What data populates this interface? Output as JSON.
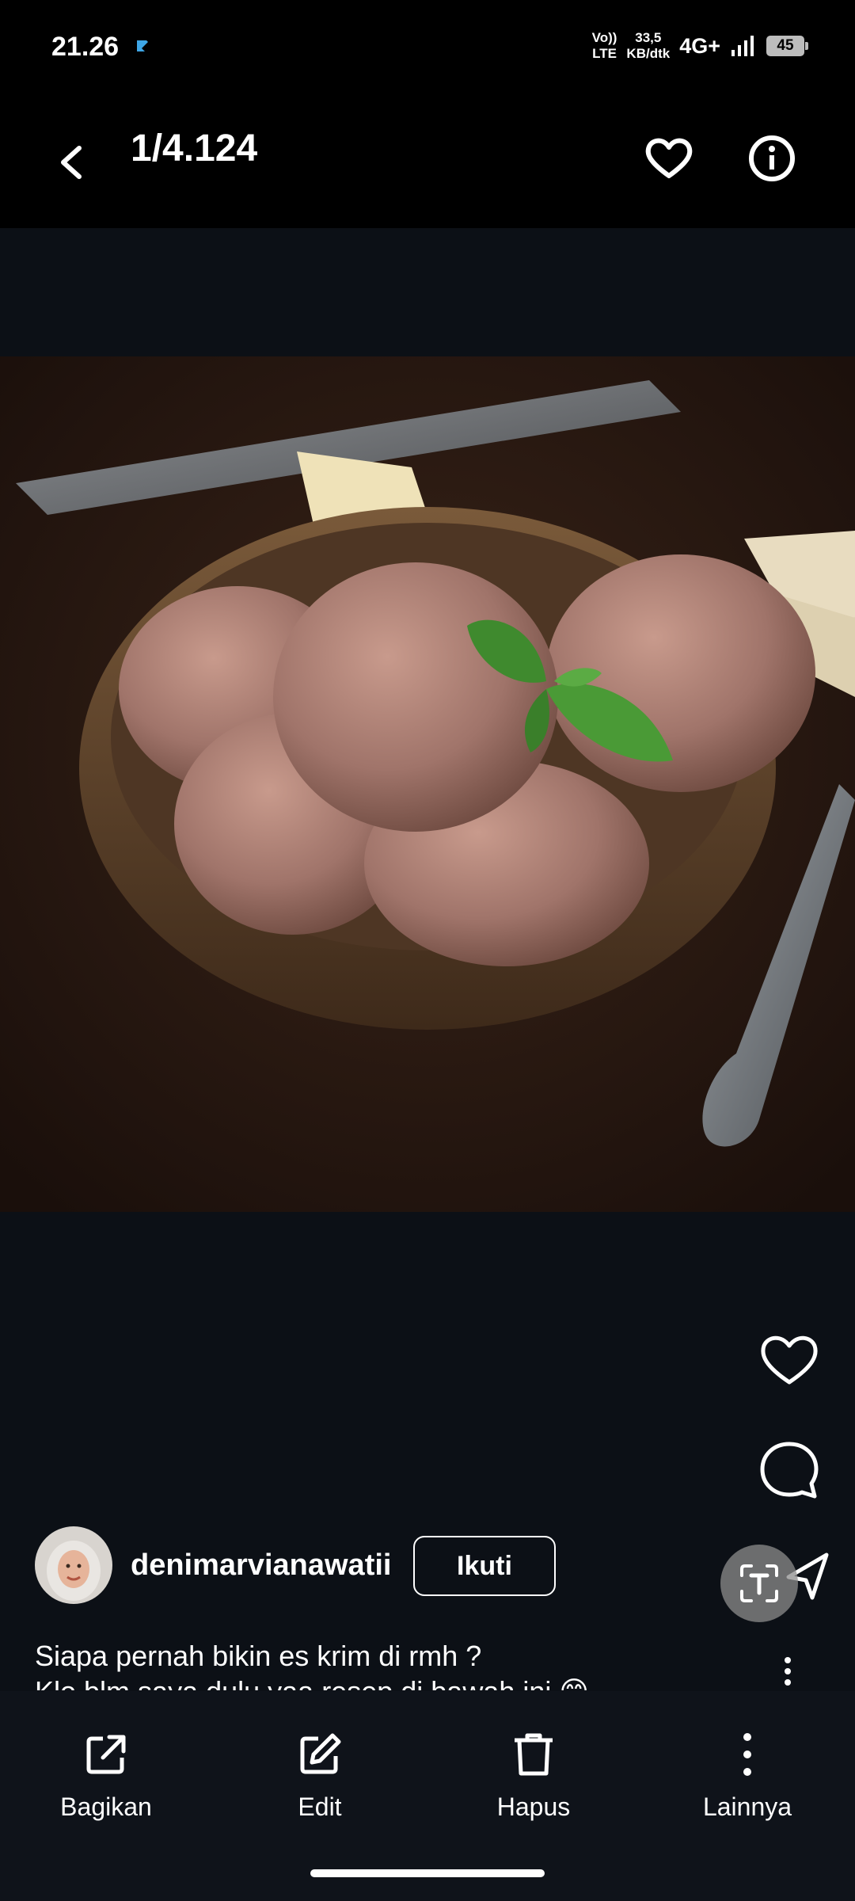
{
  "status": {
    "time": "21.26",
    "volte_top": "Vo))",
    "volte_bottom": "LTE",
    "speed_value": "33,5",
    "speed_unit": "KB/dtk",
    "network": "4G+",
    "battery": "45"
  },
  "viewer": {
    "counter": "1/4.124"
  },
  "post": {
    "username": "denimarvianawatii",
    "follow_label": "Ikuti",
    "caption_line1": "Siapa pernah bikin es krim di rmh ?",
    "caption_line2": "Klo blm saya dulu yaa resep di bawah ini 😊"
  },
  "actions": [
    {
      "label": "Bagikan",
      "icon": "share-icon"
    },
    {
      "label": "Edit",
      "icon": "edit-icon"
    },
    {
      "label": "Hapus",
      "icon": "trash-icon"
    },
    {
      "label": "Lainnya",
      "icon": "more-vertical-icon"
    }
  ],
  "colors": {
    "background": "#0c1016",
    "bars": "#000000",
    "bottom_bar": "#0f131a",
    "accent_status_icon": "#3ea6e6"
  }
}
